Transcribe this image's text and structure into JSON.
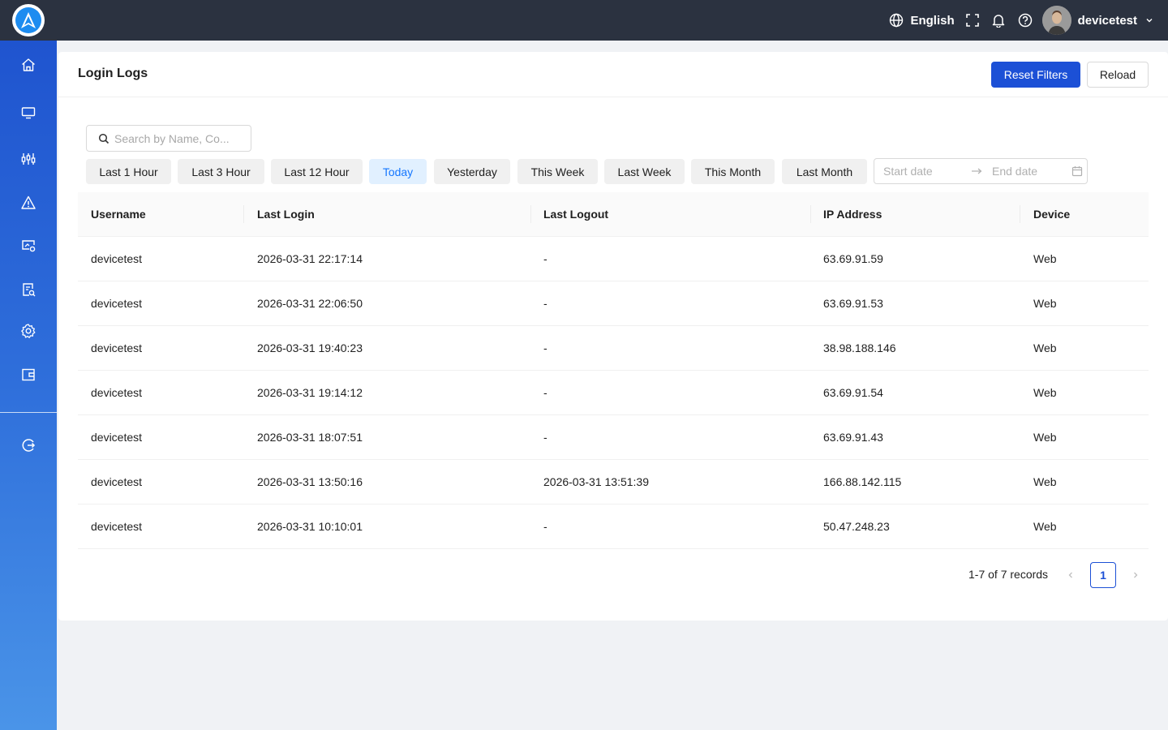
{
  "topbar": {
    "language": "English",
    "username": "devicetest"
  },
  "sidebar": {
    "items": [
      {
        "icon": "home-icon"
      },
      {
        "icon": "monitor-icon"
      },
      {
        "icon": "sliders-icon"
      },
      {
        "icon": "alert-icon"
      },
      {
        "icon": "device-settings-icon"
      },
      {
        "icon": "report-search-icon"
      },
      {
        "icon": "gear-icon"
      },
      {
        "icon": "wallet-icon"
      },
      {
        "icon": "logout-icon"
      }
    ]
  },
  "page": {
    "title": "Login Logs",
    "reset_label": "Reset Filters",
    "reload_label": "Reload"
  },
  "search": {
    "placeholder": "Search by Name, Co...",
    "value": ""
  },
  "filters": {
    "chips": [
      "Last 1 Hour",
      "Last 3 Hour",
      "Last 12 Hour",
      "Today",
      "Yesterday",
      "This Week",
      "Last Week",
      "This Month",
      "Last Month"
    ],
    "active": "Today",
    "start_placeholder": "Start date",
    "end_placeholder": "End date"
  },
  "table": {
    "columns": [
      "Username",
      "Last Login",
      "Last Logout",
      "IP Address",
      "Device"
    ],
    "rows": [
      [
        "devicetest",
        "2026-03-31 22:17:14",
        "-",
        "63.69.91.59",
        "Web"
      ],
      [
        "devicetest",
        "2026-03-31 22:06:50",
        "-",
        "63.69.91.53",
        "Web"
      ],
      [
        "devicetest",
        "2026-03-31 19:40:23",
        "-",
        "38.98.188.146",
        "Web"
      ],
      [
        "devicetest",
        "2026-03-31 19:14:12",
        "-",
        "63.69.91.54",
        "Web"
      ],
      [
        "devicetest",
        "2026-03-31 18:07:51",
        "-",
        "63.69.91.43",
        "Web"
      ],
      [
        "devicetest",
        "2026-03-31 13:50:16",
        "2026-03-31 13:51:39",
        "166.88.142.115",
        "Web"
      ],
      [
        "devicetest",
        "2026-03-31 10:10:01",
        "-",
        "50.47.248.23",
        "Web"
      ]
    ]
  },
  "pagination": {
    "total_text": "1-7 of 7 records",
    "current_page": "1"
  },
  "colors": {
    "primary": "#1c50d6",
    "topbar": "#2b3240",
    "active_chip_bg": "#e1f0ff",
    "active_chip_text": "#1677ff"
  }
}
